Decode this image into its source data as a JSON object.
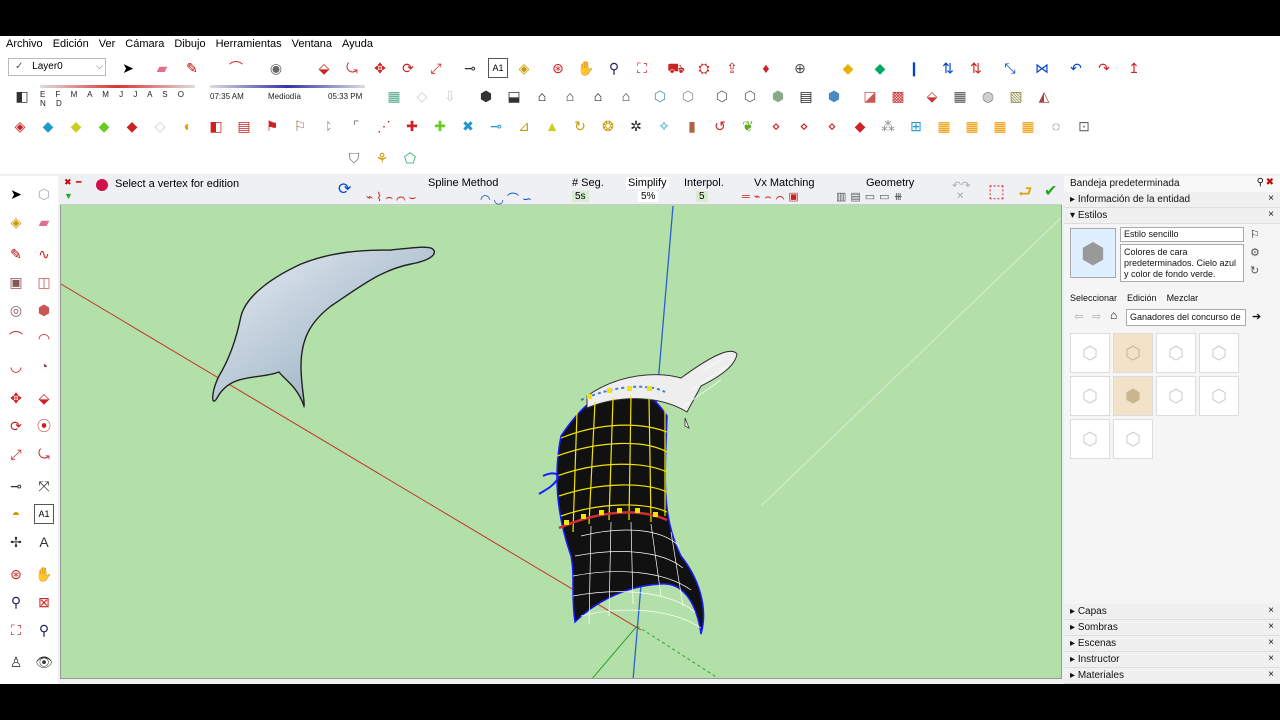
{
  "menu": [
    "Archivo",
    "Edición",
    "Ver",
    "Cámara",
    "Dibujo",
    "Herramientas",
    "Ventana",
    "Ayuda"
  ],
  "layer": {
    "name": "Layer0"
  },
  "shadow": {
    "months": "E F M A M J J A S O N D",
    "time_start": "07:35 AM",
    "time_mid": "Mediodía",
    "time_end": "05:33 PM"
  },
  "spline_toolbar": {
    "status": "Select a vertex for edition",
    "spline_method": "Spline Method",
    "segments_label": "# Seg.",
    "segments_value": "5s",
    "simplify_label": "Simplify",
    "simplify_value": "5%",
    "interpol_label": "Interpol.",
    "interpol_value": "5",
    "vx_label": "Vx Matching",
    "geometry_label": "Geometry"
  },
  "tray": {
    "title": "Bandeja predeterminada",
    "entity_info": "Información de la entidad",
    "styles": "Estilos",
    "style_name": "Estilo sencillo",
    "style_desc": "Colores de cara predeterminados. Cielo azul y color de fondo verde.",
    "tab_select": "Seleccionar",
    "tab_edit": "Edición",
    "tab_mix": "Mezclar",
    "collection": "Ganadores del concurso de",
    "panels": [
      "Capas",
      "Sombras",
      "Escenas",
      "Instructor",
      "Materiales"
    ]
  },
  "colors": {
    "viewport_bg": "#b3e0a9",
    "accent_red": "#d32f2f",
    "accent_yellow": "#f2e300"
  }
}
